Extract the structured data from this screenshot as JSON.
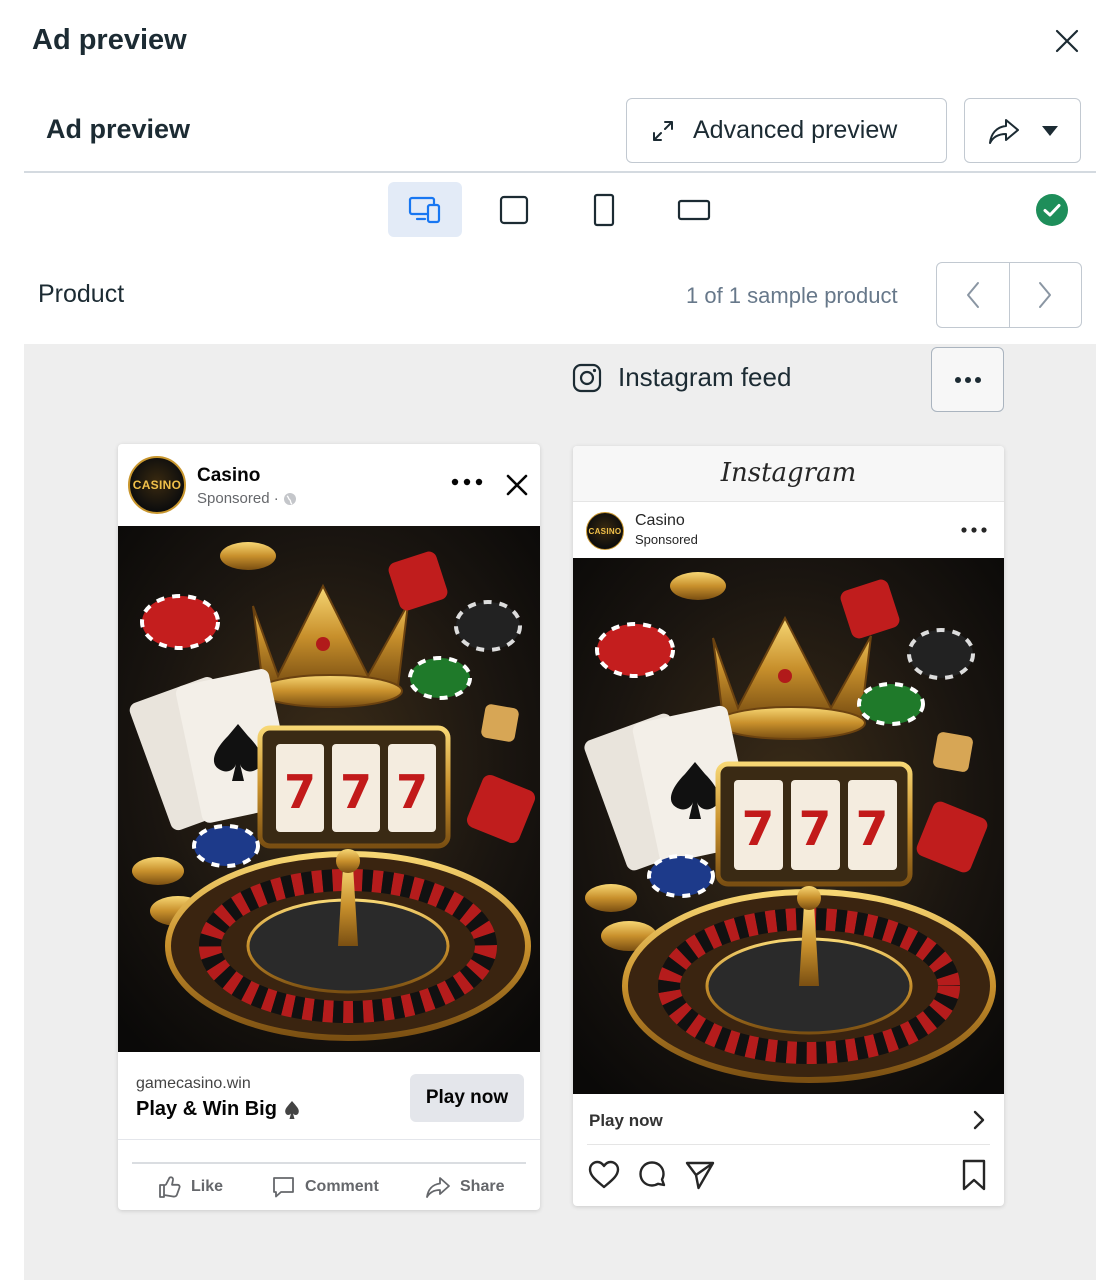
{
  "dialog": {
    "title": "Ad preview"
  },
  "header": {
    "title": "Ad preview",
    "advanced_preview_label": "Advanced preview"
  },
  "formats": [
    {
      "icon": "devices-icon",
      "active": true
    },
    {
      "icon": "square-icon",
      "active": false
    },
    {
      "icon": "portrait-icon",
      "active": false
    },
    {
      "icon": "landscape-icon",
      "active": false
    }
  ],
  "product": {
    "label": "Product",
    "sample_count": "1 of 1 sample product"
  },
  "placement": {
    "label": "Instagram feed"
  },
  "facebook_ad": {
    "page_name": "Casino",
    "sponsored": "Sponsored ·",
    "avatar_text": "CASINO",
    "domain": "gamecasino.win",
    "headline": "Play & Win Big",
    "cta": "Play now",
    "actions": {
      "like": "Like",
      "comment": "Comment",
      "share": "Share"
    }
  },
  "instagram_ad": {
    "logo": "Instagram",
    "page_name": "Casino",
    "sponsored": "Sponsored",
    "avatar_text": "CASINO",
    "cta": "Play now"
  },
  "colors": {
    "active_tab_bg": "#e3ebf7",
    "accent_blue": "#1877f2",
    "success_green": "#1e8e5a",
    "canvas_bg": "#eeeeee"
  }
}
